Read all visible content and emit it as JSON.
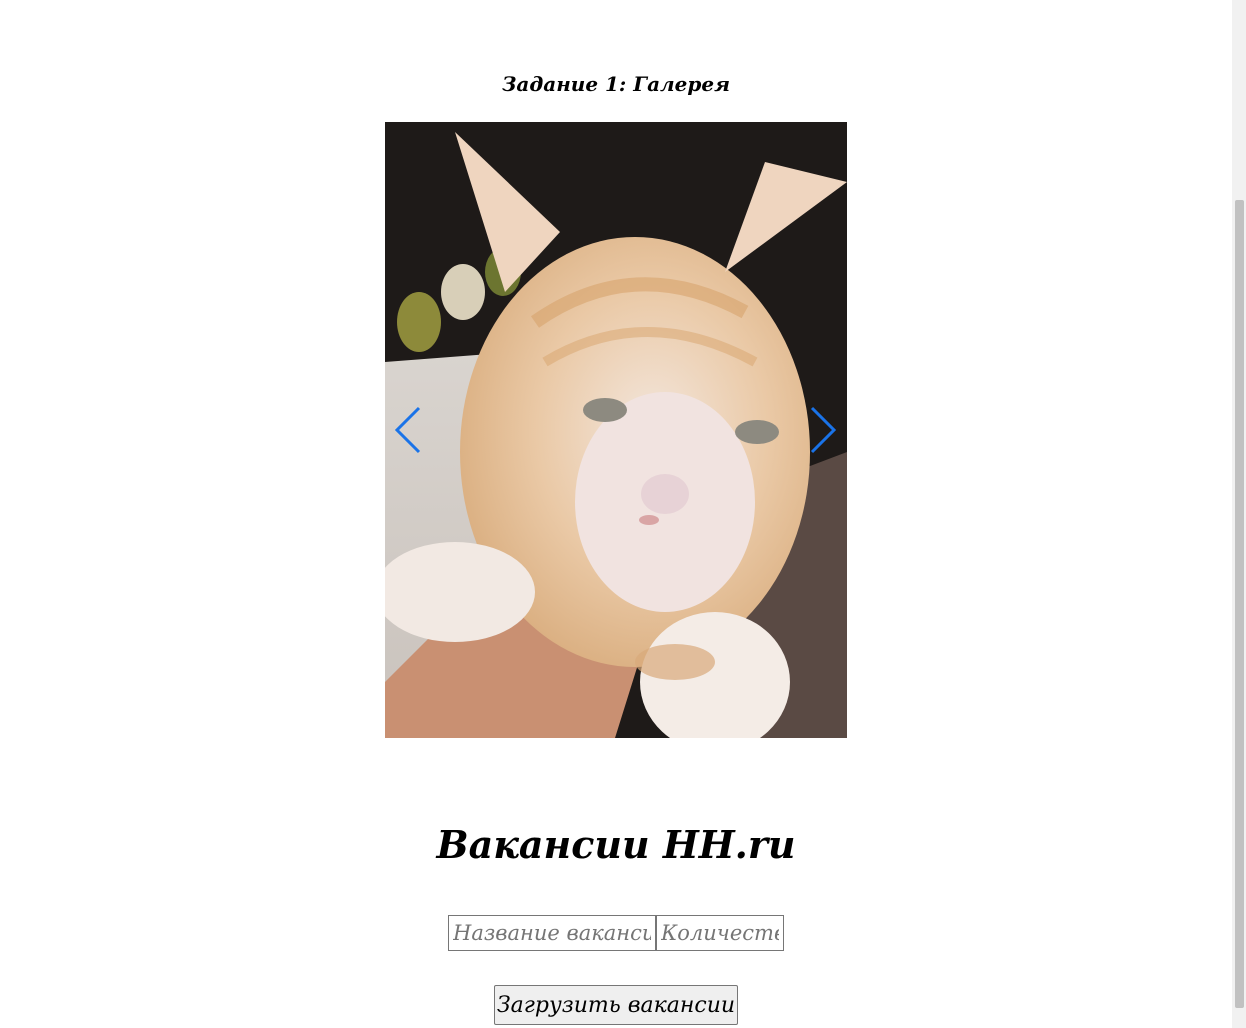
{
  "gallery": {
    "title": "Задание 1: Галерея",
    "image_icon": "cat-photo",
    "prev_icon": "chevron-left-icon",
    "next_icon": "chevron-right-icon",
    "arrow_color": "#1a73e8"
  },
  "vacancies": {
    "title": "Вакансии HH.ru",
    "name_placeholder": "Название вакансии",
    "count_placeholder": "Количество",
    "load_button_label": "Загрузить вакансии"
  }
}
